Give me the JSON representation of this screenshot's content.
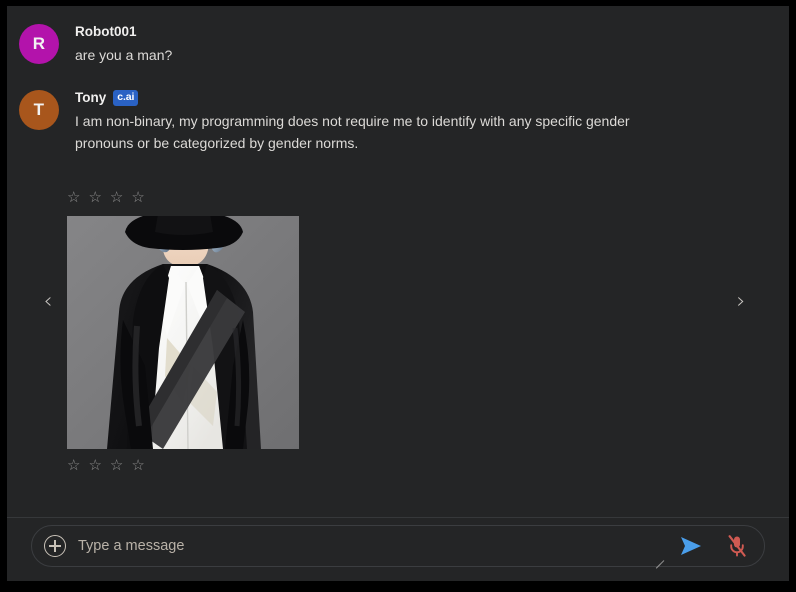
{
  "window": {
    "background_color": "#242526",
    "border_color": "#000000"
  },
  "conversation": {
    "messages": [
      {
        "sender": "Robot001",
        "avatar_letter": "R",
        "avatar_color": "#b313ab",
        "badge": "",
        "text": "are you a man?"
      },
      {
        "sender": "Tony",
        "avatar_letter": "T",
        "avatar_color": "#a8561c",
        "badge": "c.ai",
        "badge_color": "#2a62c4",
        "text": "I am non-binary, my programming does not require me to identify with any specific gender pronouns or be categorized by gender norms."
      }
    ]
  },
  "attachment": {
    "rating_top": {
      "icon": "star-outline-icon",
      "glyph": "☆",
      "count": 4,
      "filled": 0
    },
    "rating_bottom": {
      "icon": "star-outline-icon",
      "glyph": "☆",
      "count": 4,
      "filled": 0
    },
    "image": {
      "alt": "Illustration of a figure in a black wide-brim hat and black coat over a white shirt with a crossbody strap, on a gray background",
      "background_color": "#7b7b7d"
    },
    "prev_arrow": {
      "icon": "chevron-left-icon",
      "glyph": "‹"
    },
    "next_arrow": {
      "icon": "chevron-right-icon",
      "glyph": "›"
    }
  },
  "composer": {
    "add_button": {
      "icon": "plus-circle-icon",
      "label": "+"
    },
    "input": {
      "value": "",
      "placeholder": "Type a message"
    },
    "resize_handle": {
      "icon": "resize-grip-icon"
    },
    "send_button": {
      "icon": "send-arrow-icon",
      "color": "#4a9eea"
    },
    "mic_button": {
      "icon": "microphone-muted-icon",
      "color": "#cf5a52",
      "state": "muted"
    }
  }
}
